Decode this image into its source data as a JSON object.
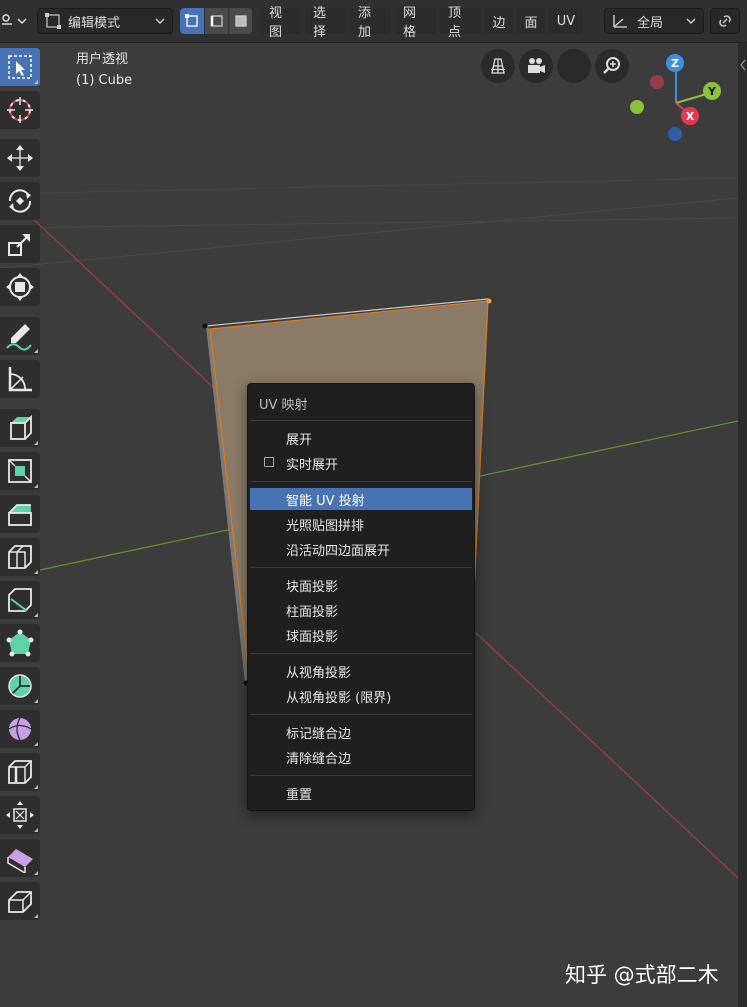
{
  "header": {
    "mode_dropdown": "编辑模式",
    "menus": [
      "视图",
      "选择",
      "添加",
      "网格",
      "顶点",
      "边",
      "面",
      "UV"
    ],
    "transform_dropdown": "全局"
  },
  "viewport": {
    "view_name": "用户透视",
    "object_name": "(1) Cube"
  },
  "gizmo": {
    "z": "Z",
    "y": "Y",
    "x": "X"
  },
  "context_menu": {
    "title": "UV 映射",
    "items": [
      {
        "label": "展开"
      },
      {
        "label": "实时展开"
      },
      {
        "label": "智能 UV 投射"
      },
      {
        "label": "光照贴图拼排"
      },
      {
        "label": "沿活动四边面展开"
      },
      {
        "label": "块面投影"
      },
      {
        "label": "柱面投影"
      },
      {
        "label": "球面投影"
      },
      {
        "label": "从视角投影"
      },
      {
        "label": "从视角投影 (限界)"
      },
      {
        "label": "标记缝合边"
      },
      {
        "label": "清除缝合边"
      },
      {
        "label": "重置"
      }
    ]
  },
  "watermark": "知乎 @式部二木",
  "colors": {
    "accent": "#4772b3",
    "axis_x": "#e8364f",
    "axis_y": "#8ac23a",
    "axis_z": "#3f8fe0",
    "face_selected": "#8a7a66",
    "edge_selected": "#ff8a00"
  }
}
